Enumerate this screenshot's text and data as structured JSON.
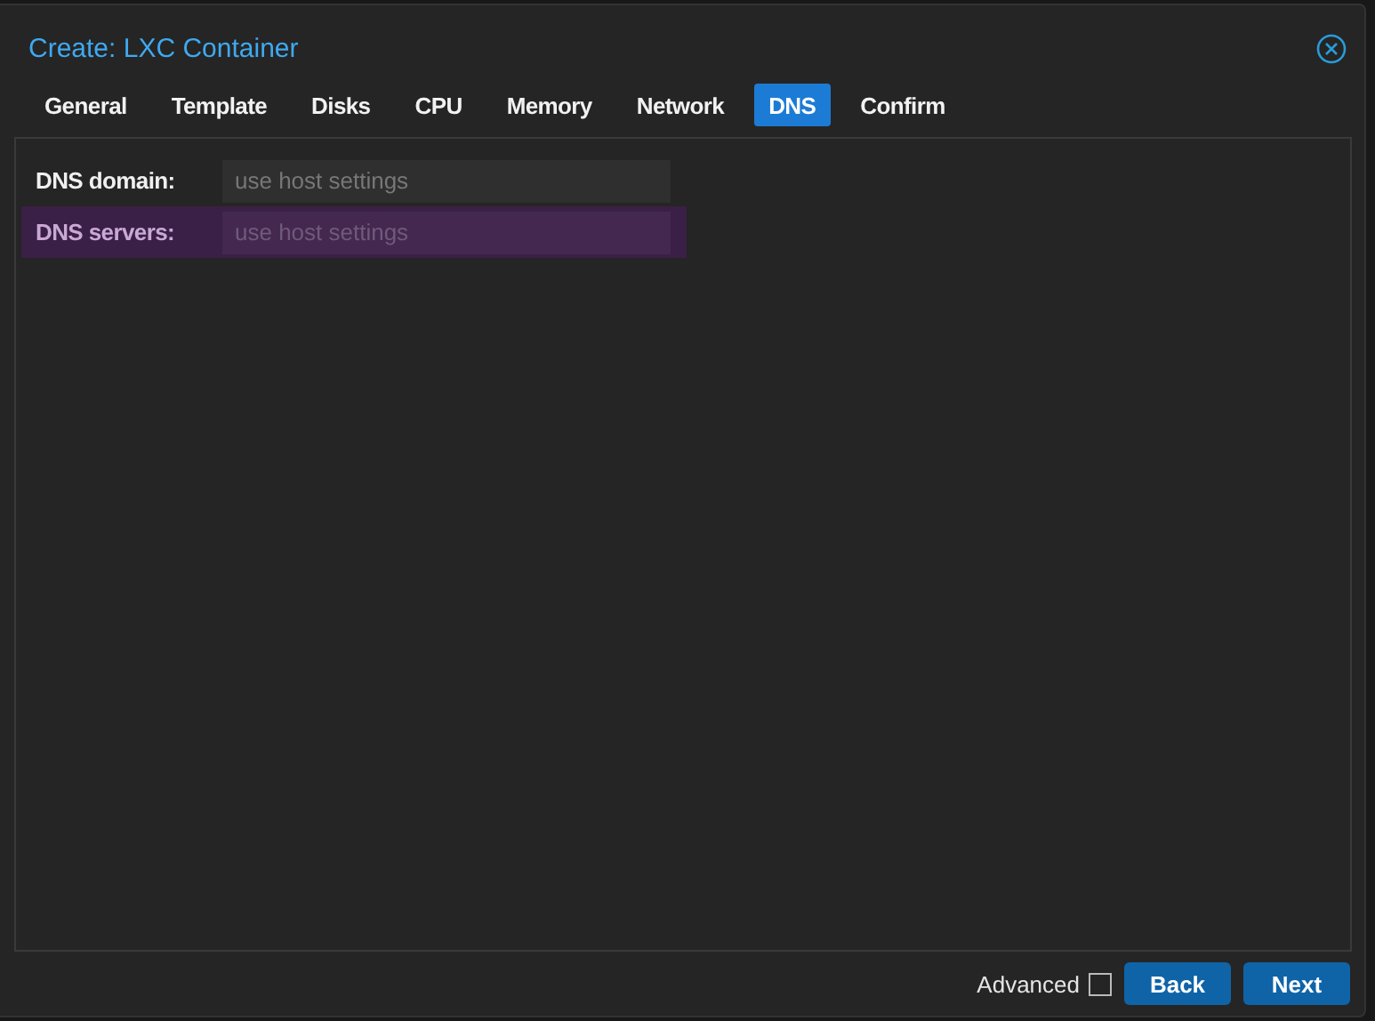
{
  "window": {
    "title": "Create: LXC Container"
  },
  "tabs": [
    {
      "label": "General",
      "selected": false
    },
    {
      "label": "Template",
      "selected": false
    },
    {
      "label": "Disks",
      "selected": false
    },
    {
      "label": "CPU",
      "selected": false
    },
    {
      "label": "Memory",
      "selected": false
    },
    {
      "label": "Network",
      "selected": false
    },
    {
      "label": "DNS",
      "selected": true
    },
    {
      "label": "Confirm",
      "selected": false
    }
  ],
  "fields": [
    {
      "label": "DNS domain:",
      "placeholder": "use host settings",
      "highlighted": false
    },
    {
      "label": "DNS servers:",
      "placeholder": "use host settings",
      "highlighted": true
    }
  ],
  "footer": {
    "advanced": {
      "label": "Advanced",
      "checked": false
    },
    "buttons": [
      "Back",
      "Next"
    ]
  }
}
